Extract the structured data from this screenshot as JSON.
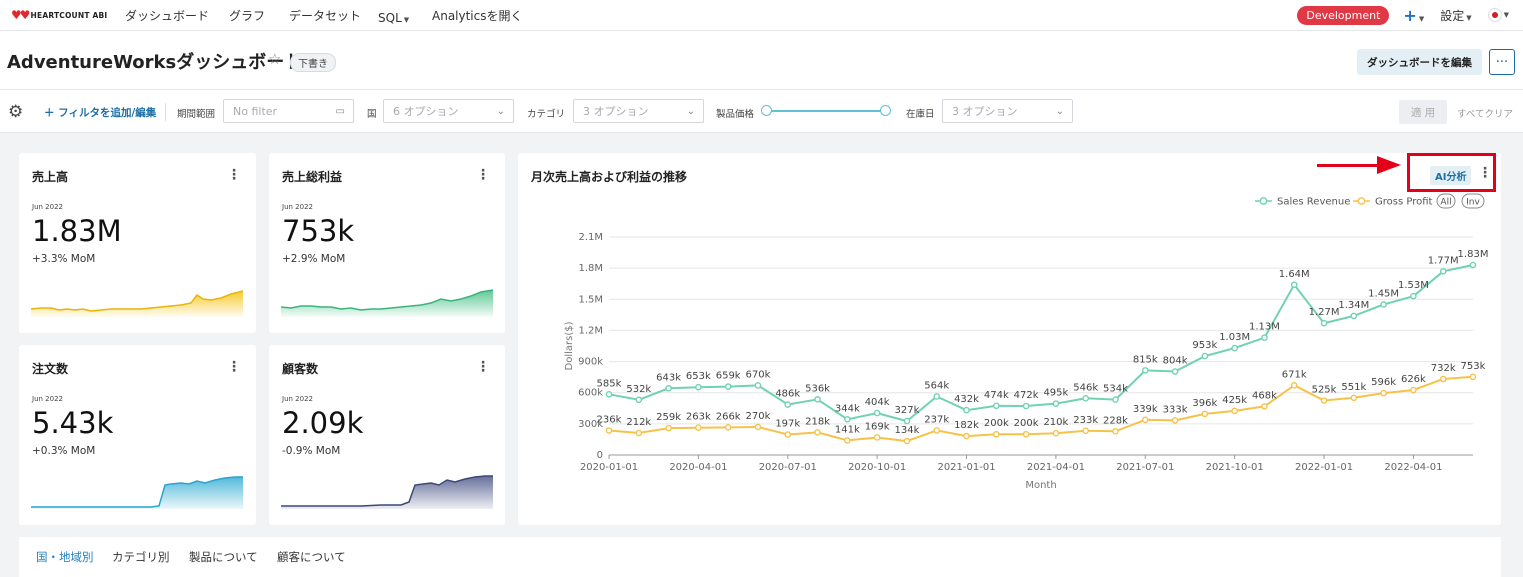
{
  "nav": {
    "logo": "HEARTCOUNT ABI",
    "items": [
      "ダッシュボード",
      "グラフ",
      "データセット",
      "SQL",
      "Analyticsを開く"
    ],
    "env": "Development",
    "plus": "+",
    "settings": "設定"
  },
  "header": {
    "title": "AdventureWorksダッシュボート",
    "badge": "下書き",
    "edit_label": "ダッシュボードを編集",
    "more": "···"
  },
  "filters": {
    "add_label": "フィルタを追加/編集",
    "period_label": "期間範囲",
    "period_placeholder": "No filter",
    "country_label": "国",
    "country_placeholder": "6 オプション",
    "category_label": "カテゴリ",
    "category_placeholder": "3 オプション",
    "price_label": "製品価格",
    "stock_label": "在庫日",
    "stock_placeholder": "3 オプション",
    "apply_label": "適 用",
    "clear_label": "すべてクリア"
  },
  "kpis": [
    {
      "title": "売上高",
      "date": "Jun 2022",
      "value": "1.83M",
      "mom": "+3.3% MoM",
      "color": "#f5c518"
    },
    {
      "title": "売上総利益",
      "date": "Jun 2022",
      "value": "753k",
      "mom": "+2.9% MoM",
      "color": "#4cc38a"
    },
    {
      "title": "注文数",
      "date": "Jun 2022",
      "value": "5.43k",
      "mom": "+0.3% MoM",
      "color": "#3fb2d6"
    },
    {
      "title": "顧客数",
      "date": "Jun 2022",
      "value": "2.09k",
      "mom": "-0.9% MoM",
      "color": "#545f8f"
    }
  ],
  "chart": {
    "title": "月次売上高および利益の推移",
    "ai_label": "AI分析",
    "legend_all": "All",
    "legend_inv": "Inv"
  },
  "tabs": [
    "国・地域別",
    "カテゴリ別",
    "製品について",
    "顧客について"
  ],
  "chart_data": {
    "type": "line",
    "xlabel": "Month",
    "ylabel": "Dollars($)",
    "ylim": [
      0,
      2100000
    ],
    "y_ticks": [
      "0",
      "300k",
      "600k",
      "900k",
      "1.2M",
      "1.5M",
      "1.8M",
      "2.1M"
    ],
    "x_ticks": [
      "2020-01-01",
      "2020-04-01",
      "2020-07-01",
      "2020-10-01",
      "2021-01-01",
      "2021-04-01",
      "2021-07-01",
      "2021-10-01",
      "2022-01-01",
      "2022-04-01"
    ],
    "x": [
      "2020-01",
      "2020-02",
      "2020-03",
      "2020-04",
      "2020-05",
      "2020-06",
      "2020-07",
      "2020-08",
      "2020-09",
      "2020-10",
      "2020-11",
      "2020-12",
      "2021-01",
      "2021-02",
      "2021-03",
      "2021-04",
      "2021-05",
      "2021-06",
      "2021-07",
      "2021-08",
      "2021-09",
      "2021-10",
      "2021-11",
      "2021-12",
      "2022-01",
      "2022-02",
      "2022-03",
      "2022-04",
      "2022-05",
      "2022-06"
    ],
    "series": [
      {
        "name": "Sales Revenue",
        "color": "#6fd3b0",
        "values": [
          585000,
          532000,
          643000,
          653000,
          659000,
          670000,
          486000,
          536000,
          344000,
          404000,
          327000,
          564000,
          432000,
          474000,
          472000,
          495000,
          546000,
          534000,
          815000,
          804000,
          953000,
          1030000,
          1130000,
          1640000,
          1270000,
          1340000,
          1450000,
          1530000,
          1770000,
          1830000
        ],
        "labels": [
          "585k",
          "532k",
          "643k",
          "653k",
          "659k",
          "670k",
          "486k",
          "536k",
          "344k",
          "404k",
          "327k",
          "564k",
          "432k",
          "474k",
          "472k",
          "495k",
          "546k",
          "534k",
          "815k",
          "804k",
          "953k",
          "1.03M",
          "1.13M",
          "1.64M",
          "1.27M",
          "1.34M",
          "1.45M",
          "1.53M",
          "1.77M",
          "1.83M"
        ]
      },
      {
        "name": "Gross Profit",
        "color": "#f7c24a",
        "values": [
          236000,
          212000,
          259000,
          263000,
          266000,
          270000,
          197000,
          218000,
          141000,
          169000,
          134000,
          237000,
          182000,
          200000,
          200000,
          210000,
          233000,
          228000,
          339000,
          333000,
          396000,
          425000,
          468000,
          671000,
          525000,
          551000,
          596000,
          626000,
          732000,
          753000
        ],
        "labels": [
          "236k",
          "212k",
          "259k",
          "263k",
          "266k",
          "270k",
          "197k",
          "218k",
          "141k",
          "169k",
          "134k",
          "237k",
          "182k",
          "200k",
          "200k",
          "210k",
          "233k",
          "228k",
          "339k",
          "333k",
          "396k",
          "425k",
          "468k",
          "671k",
          "525k",
          "551k",
          "596k",
          "626k",
          "732k",
          "753k"
        ]
      }
    ]
  }
}
